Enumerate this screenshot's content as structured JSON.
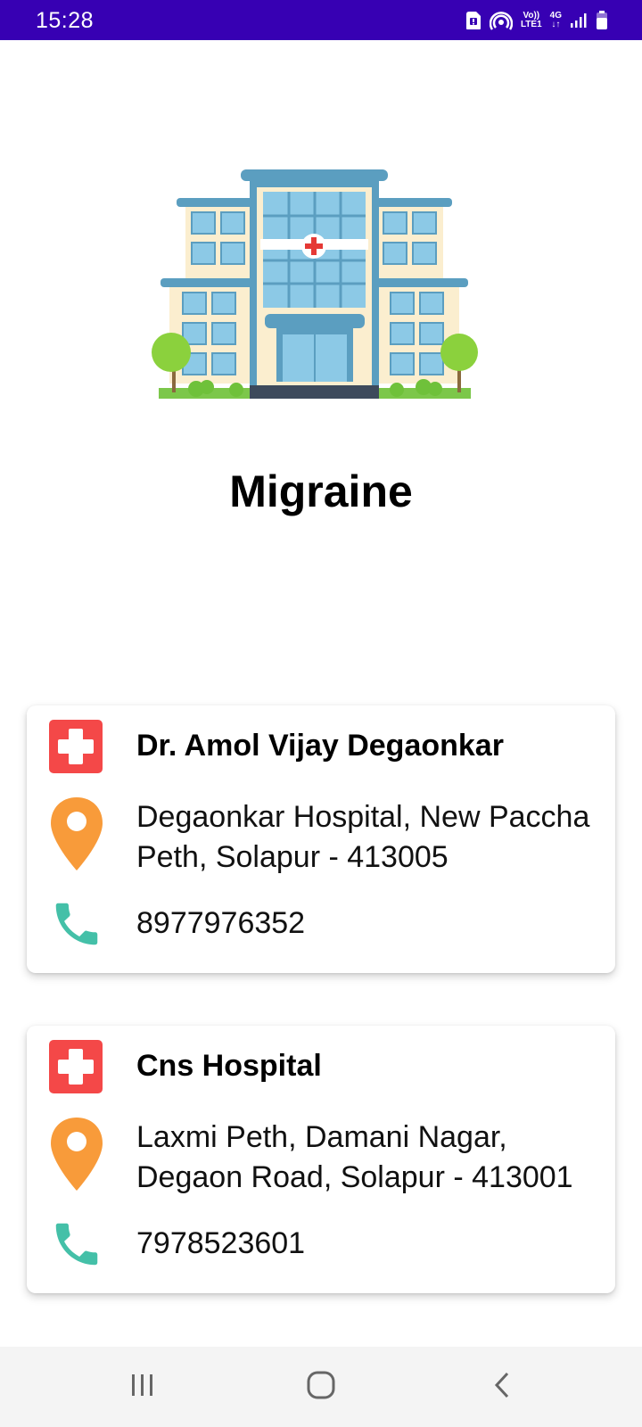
{
  "status_bar": {
    "time": "15:28",
    "volte_label": "Vo))",
    "lte_label": "LTE1",
    "network_label": "4G",
    "icons": [
      "sim-alert-icon",
      "hotspot-icon",
      "volte-icon",
      "4g-data-icon",
      "signal-icon",
      "battery-icon"
    ]
  },
  "hero": {
    "image": "hospital-building-illustration"
  },
  "page": {
    "title": "Migraine"
  },
  "doctors": [
    {
      "name": "Dr. Amol Vijay Degaonkar",
      "address": "Degaonkar Hospital, New Paccha Peth, Solapur - 413005",
      "phone": "8977976352"
    },
    {
      "name": "Cns Hospital",
      "address": "Laxmi Peth, Damani Nagar, Degaon Road, Solapur - 413001",
      "phone": "7978523601"
    }
  ],
  "colors": {
    "status_bar": "#3700b3",
    "cross_icon": "#f44848",
    "pin_icon": "#f89b3a",
    "phone_icon": "#44c0a8"
  },
  "nav": {
    "buttons": [
      "recents-icon",
      "home-icon",
      "back-icon"
    ]
  }
}
